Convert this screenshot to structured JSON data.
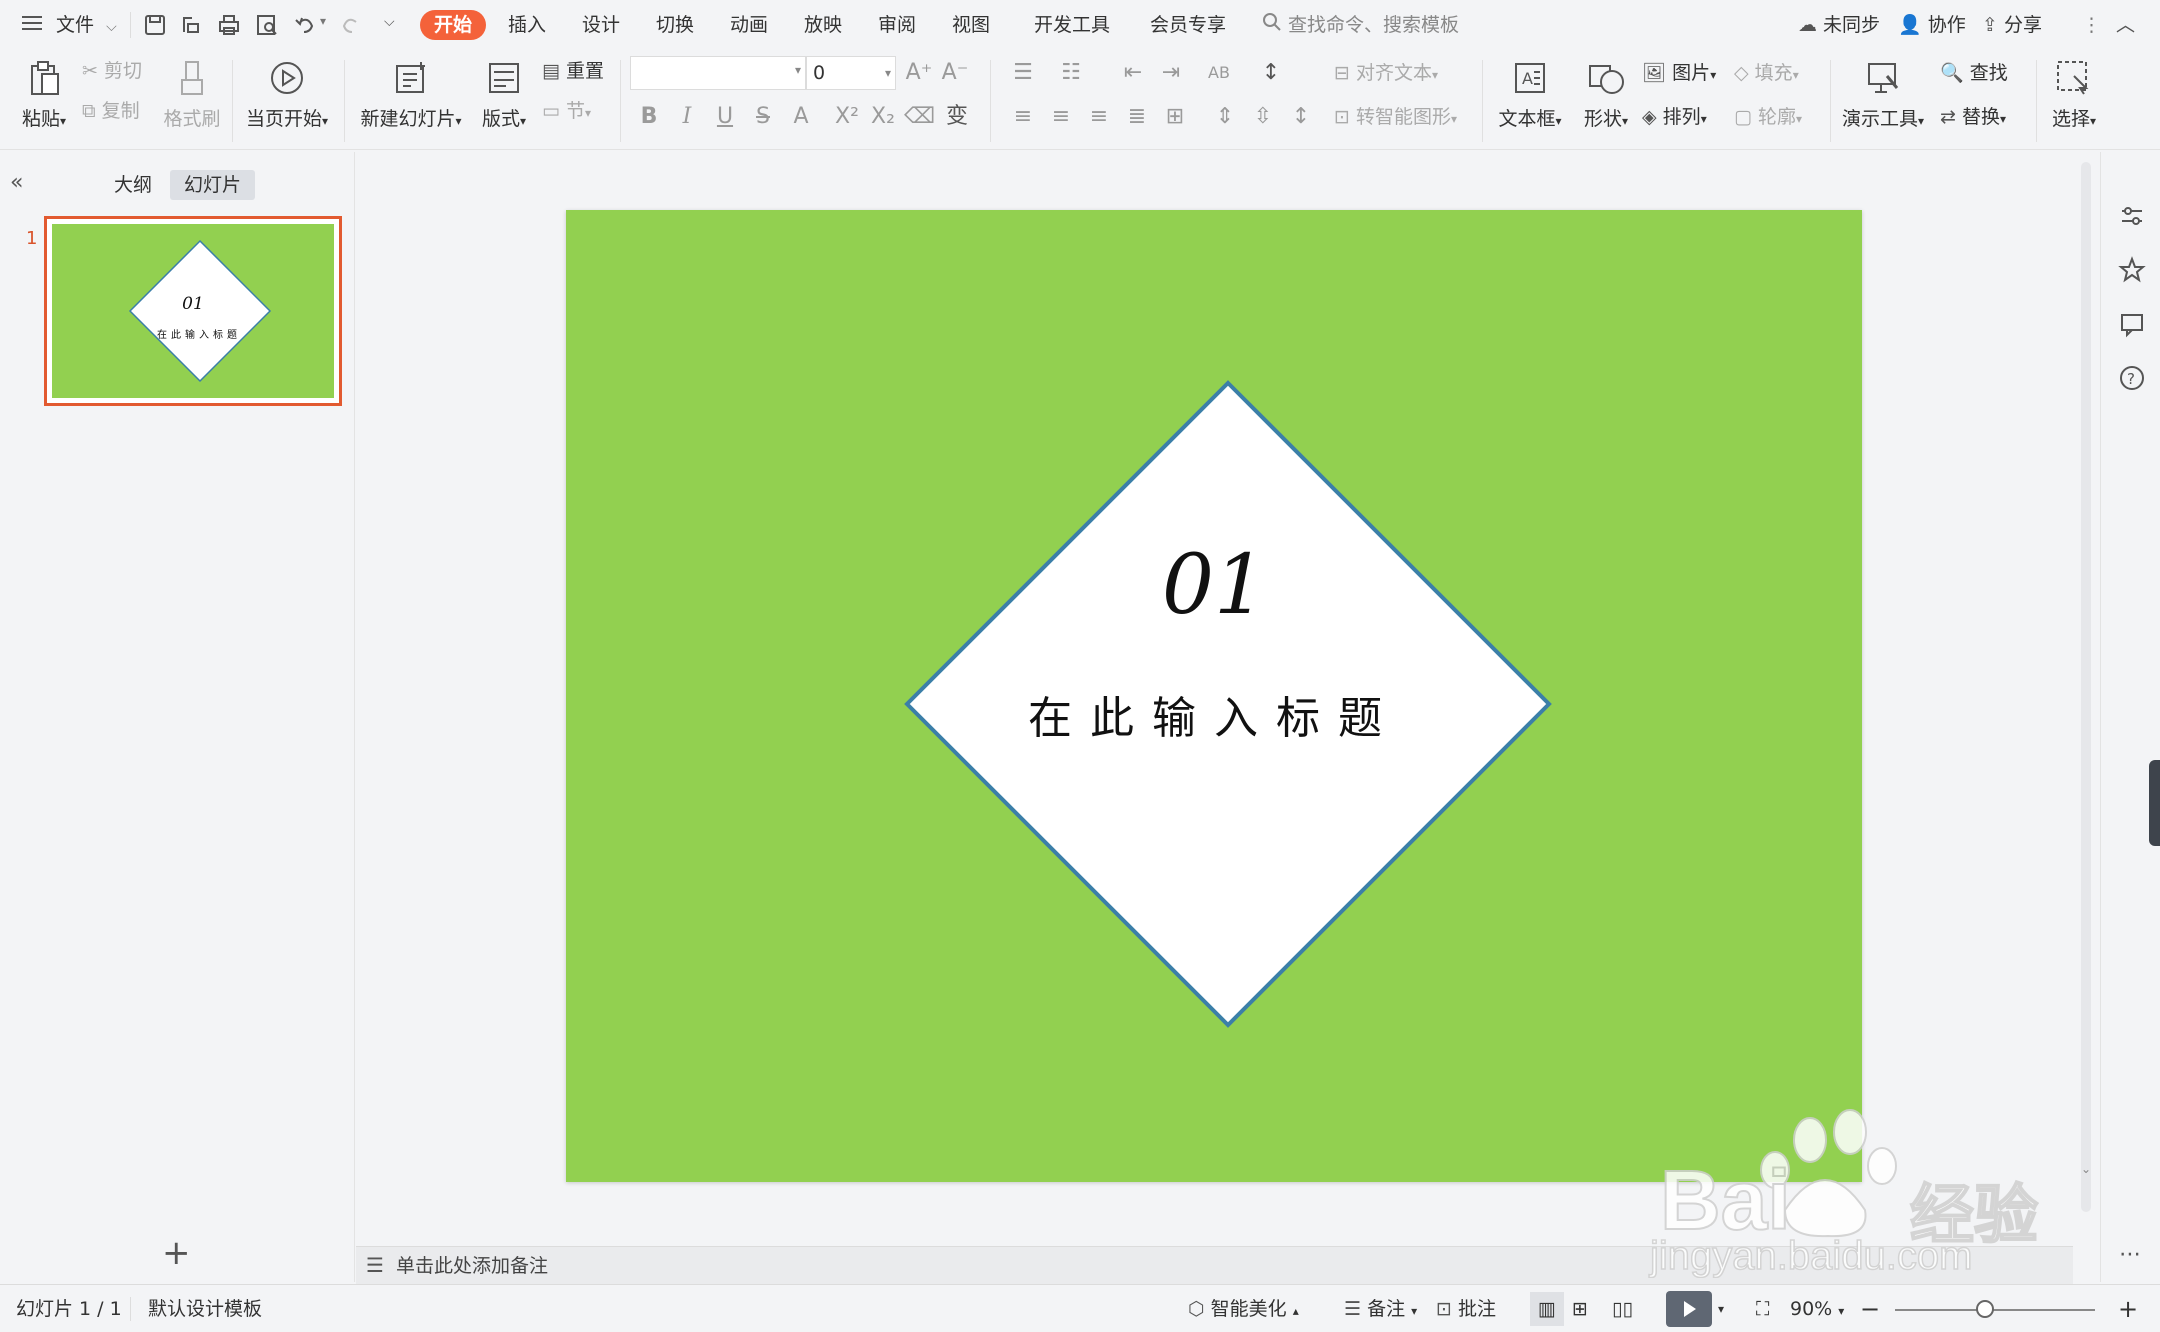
{
  "menu": {
    "file_label": "文件",
    "tabs": [
      "开始",
      "插入",
      "设计",
      "切换",
      "动画",
      "放映",
      "审阅",
      "视图",
      "开发工具",
      "会员专享"
    ],
    "search_placeholder": "查找命令、搜索模板",
    "sync_label": "未同步",
    "collab_label": "协作",
    "share_label": "分享"
  },
  "ribbon": {
    "paste": "粘贴",
    "cut": "剪切",
    "copy": "复制",
    "format_painter": "格式刷",
    "play_from_current": "当页开始",
    "new_slide": "新建幻灯片",
    "layout": "版式",
    "reset": "重置",
    "section": "节",
    "font_size": "0",
    "align_text": "对齐文本",
    "smart_art": "转智能图形",
    "textbox": "文本框",
    "shape": "形状",
    "picture": "图片",
    "arrange": "排列",
    "fill": "填充",
    "outline": "轮廓",
    "present_tools": "演示工具",
    "find": "查找",
    "replace": "替换",
    "select": "选择"
  },
  "left_panel": {
    "tab_outline": "大纲",
    "tab_slides": "幻灯片",
    "thumb_number": "1"
  },
  "slide": {
    "number": "01",
    "title": "在此输入标题",
    "background": "#92d050",
    "diamond_border": "#3b7fa8"
  },
  "notes": {
    "placeholder": "单击此处添加备注"
  },
  "status": {
    "slide_counter": "幻灯片 1 / 1",
    "template": "默认设计模板",
    "beautify": "智能美化",
    "notes": "备注",
    "comment": "批注",
    "zoom": "90%"
  },
  "watermark": {
    "brand": "Bai",
    "brand_suffix": "经验",
    "url": "jingyan.baidu.com"
  }
}
